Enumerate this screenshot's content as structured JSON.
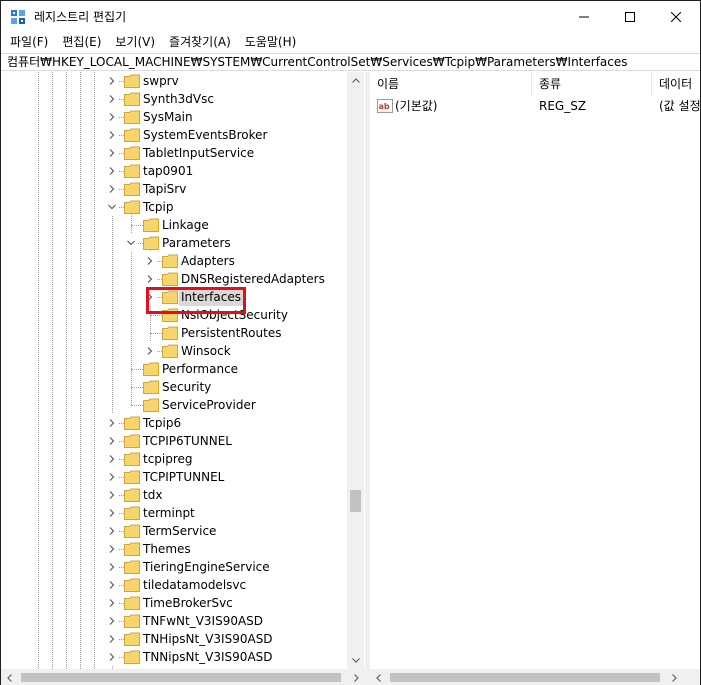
{
  "window": {
    "title": "레지스트리 편집기"
  },
  "menu": [
    {
      "label": "파일(F)"
    },
    {
      "label": "편집(E)"
    },
    {
      "label": "보기(V)"
    },
    {
      "label": "즐겨찾기(A)"
    },
    {
      "label": "도움말(H)"
    }
  ],
  "address": "컴퓨터₩HKEY_LOCAL_MACHINE₩SYSTEM₩CurrentControlSet₩Services₩Tcpip₩Parameters₩Interfaces",
  "tree": [
    {
      "label": "swprv",
      "level": 0,
      "expander": "collapsed"
    },
    {
      "label": "Synth3dVsc",
      "level": 0,
      "expander": "collapsed"
    },
    {
      "label": "SysMain",
      "level": 0,
      "expander": "collapsed"
    },
    {
      "label": "SystemEventsBroker",
      "level": 0,
      "expander": "collapsed"
    },
    {
      "label": "TabletInputService",
      "level": 0,
      "expander": "collapsed"
    },
    {
      "label": "tap0901",
      "level": 0,
      "expander": "collapsed"
    },
    {
      "label": "TapiSrv",
      "level": 0,
      "expander": "collapsed"
    },
    {
      "label": "Tcpip",
      "level": 0,
      "expander": "expanded"
    },
    {
      "label": "Linkage",
      "level": 1,
      "expander": "none"
    },
    {
      "label": "Parameters",
      "level": 1,
      "expander": "expanded"
    },
    {
      "label": "Adapters",
      "level": 2,
      "expander": "collapsed"
    },
    {
      "label": "DNSRegisteredAdapters",
      "level": 2,
      "expander": "collapsed"
    },
    {
      "label": "Interfaces",
      "level": 2,
      "expander": "collapsed",
      "selected": true
    },
    {
      "label": "NsiObjectSecurity",
      "level": 2,
      "expander": "none"
    },
    {
      "label": "PersistentRoutes",
      "level": 2,
      "expander": "none"
    },
    {
      "label": "Winsock",
      "level": 2,
      "expander": "collapsed"
    },
    {
      "label": "Performance",
      "level": 1,
      "expander": "none"
    },
    {
      "label": "Security",
      "level": 1,
      "expander": "none"
    },
    {
      "label": "ServiceProvider",
      "level": 1,
      "expander": "none"
    },
    {
      "label": "Tcpip6",
      "level": 0,
      "expander": "collapsed"
    },
    {
      "label": "TCPIP6TUNNEL",
      "level": 0,
      "expander": "collapsed"
    },
    {
      "label": "tcpipreg",
      "level": 0,
      "expander": "collapsed"
    },
    {
      "label": "TCPIPTUNNEL",
      "level": 0,
      "expander": "collapsed"
    },
    {
      "label": "tdx",
      "level": 0,
      "expander": "collapsed"
    },
    {
      "label": "terminpt",
      "level": 0,
      "expander": "collapsed"
    },
    {
      "label": "TermService",
      "level": 0,
      "expander": "collapsed"
    },
    {
      "label": "Themes",
      "level": 0,
      "expander": "collapsed"
    },
    {
      "label": "TieringEngineService",
      "level": 0,
      "expander": "collapsed"
    },
    {
      "label": "tiledatamodelsvc",
      "level": 0,
      "expander": "collapsed"
    },
    {
      "label": "TimeBrokerSvc",
      "level": 0,
      "expander": "collapsed"
    },
    {
      "label": "TNFwNt_V3IS90ASD",
      "level": 0,
      "expander": "collapsed"
    },
    {
      "label": "TNHipsNt_V3IS90ASD",
      "level": 0,
      "expander": "collapsed"
    },
    {
      "label": "TNNipsNt_V3IS90ASD",
      "level": 0,
      "expander": "collapsed"
    }
  ],
  "columns": {
    "name": "이름",
    "type": "종류",
    "data": "데이터"
  },
  "values": [
    {
      "icon": "string-value-icon",
      "name": "(기본값)",
      "type": "REG_SZ",
      "data": "(값 설정 안 됨)"
    }
  ],
  "colors": {
    "highlight": "#e0101a",
    "folder": "#f7d56e",
    "folder_edge": "#d6a62f",
    "selected_bg": "#d9d9d9"
  }
}
